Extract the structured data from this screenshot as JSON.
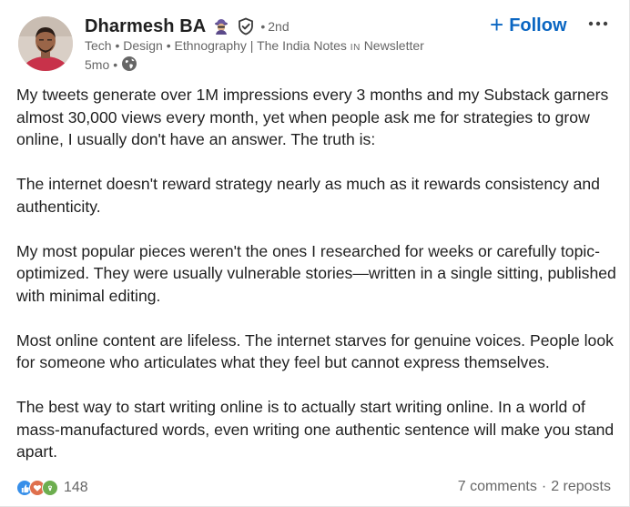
{
  "author": {
    "name": "Dharmesh BA",
    "degree": "2nd",
    "headline": "Tech • Design • Ethnography | The India Notes",
    "headline_badge": "IN",
    "headline_suffix": "Newsletter",
    "posted": "5mo",
    "visibility_icon": "globe-icon"
  },
  "actions": {
    "follow_label": "Follow",
    "more_icon": "more-icon"
  },
  "post": {
    "paragraphs": [
      "My tweets generate over 1M impressions every 3 months and my Substack garners almost 30,000 views every month, yet when people ask me for strategies to grow online, I usually don't have an answer. The truth is:",
      "The internet doesn't reward strategy nearly as much as it rewards consistency and authenticity.",
      "My most popular pieces weren't the ones I researched for weeks or carefully topic-optimized. They were usually vulnerable stories—written in a single sitting, published with minimal editing.",
      "Most online content are lifeless. The internet starves for genuine voices. People look for someone who articulates what they feel but cannot express themselves.",
      "The best way to start writing online is to actually start writing online. In a world of mass-manufactured words, even writing one authentic sentence will make you stand apart."
    ]
  },
  "social": {
    "reaction_icons": [
      "like-icon",
      "love-icon",
      "celebrate-icon"
    ],
    "reaction_count": "148",
    "comments": "7 comments",
    "reposts": "2 reposts"
  },
  "colors": {
    "link_blue": "#0a66c2",
    "secondary_text": "#666666",
    "like": "#378fe9",
    "love": "#df704d",
    "celebrate": "#6dae4f"
  }
}
